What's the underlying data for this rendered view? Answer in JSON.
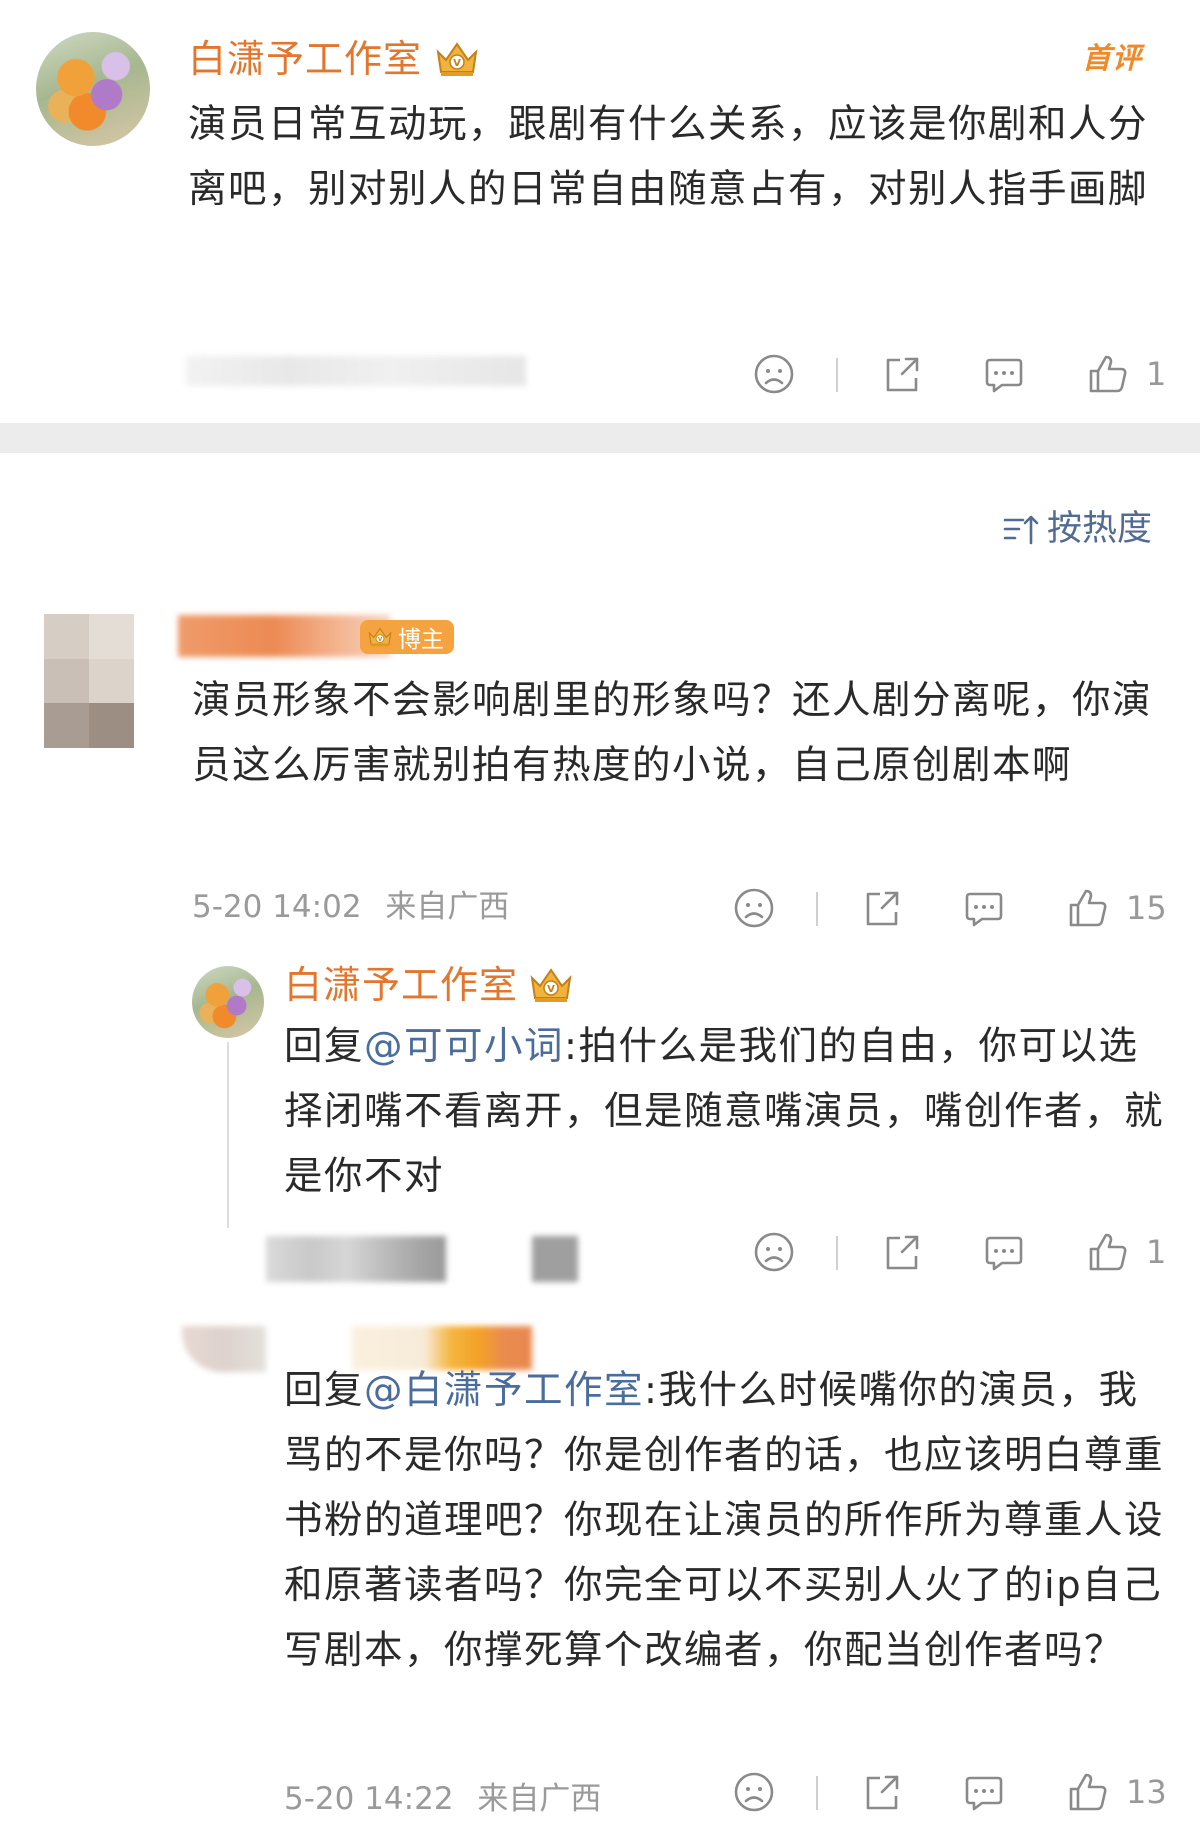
{
  "first_comment": {
    "author": "白潇予工作室",
    "badge": "首评",
    "text": "演员日常互动玩，跟剧有什么关系，应该是你剧和人分离吧，别对别人的日常自由随意占有，对别人指手画脚",
    "like_count": "1"
  },
  "sort": {
    "label": "按热度"
  },
  "main_comment": {
    "author_badge": "博主",
    "text": "演员形象不会影响剧里的形象吗？还人剧分离呢，你演员这么厉害就别拍有热度的小说，自己原创剧本啊",
    "time": "5-20 14:02",
    "location": "来自广西",
    "like_count": "15"
  },
  "reply_1": {
    "author": "白潇予工作室",
    "prefix": "回复",
    "mention": "@可可小词",
    "text": ":拍什么是我们的自由，你可以选择闭嘴不看离开，但是随意嘴演员，嘴创作者，就是你不对",
    "like_count": "1"
  },
  "reply_2": {
    "prefix": "回复",
    "mention": "@白潇予工作室",
    "text": ":我什么时候嘴你的演员，我骂的不是你吗？你是创作者的话，也应该明白尊重书粉的道理吧？你现在让演员的所作所为尊重人设和原著读者吗？你完全可以不买别人火了的ip自己写剧本，你撑死算个改编者，你配当创作者吗？",
    "time": "5-20 14:22",
    "location": "来自广西",
    "like_count": "13"
  },
  "icons": [
    "sad-face-icon",
    "share-icon",
    "comment-icon",
    "thumbs-up-icon",
    "sort-icon",
    "crown-icon"
  ],
  "colors": {
    "name_orange": "#e3762d",
    "mention_blue": "#4b6d9c",
    "meta_gray": "#9a9a9a",
    "badge_orange": "#f5a340"
  }
}
